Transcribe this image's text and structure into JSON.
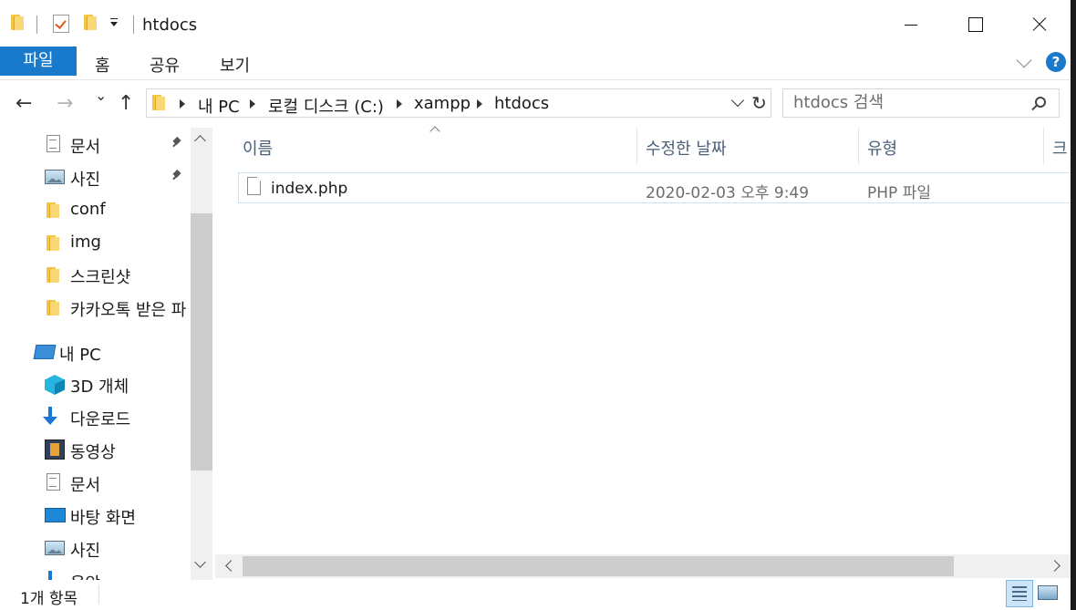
{
  "window": {
    "title": "htdocs"
  },
  "ribbon": {
    "tabs": [
      "파일",
      "홈",
      "공유",
      "보기"
    ],
    "help_label": "?"
  },
  "address": {
    "crumbs": [
      "내 PC",
      "로컬 디스크 (C:)",
      "xampp",
      "htdocs"
    ],
    "refresh_glyph": "↻"
  },
  "nav": {
    "back": "←",
    "forward": "→",
    "recent": "⌄",
    "up": "↑"
  },
  "search": {
    "placeholder": "htdocs 검색"
  },
  "navpane": {
    "quick": [
      {
        "label": "문서",
        "icon": "document-icon",
        "pinned": true
      },
      {
        "label": "사진",
        "icon": "pictures-icon",
        "pinned": true
      },
      {
        "label": "conf",
        "icon": "folder-icon",
        "pinned": false
      },
      {
        "label": "img",
        "icon": "folder-icon",
        "pinned": false
      },
      {
        "label": "스크린샷",
        "icon": "folder-icon",
        "pinned": false
      },
      {
        "label": "카카오톡 받은 파",
        "icon": "folder-icon",
        "pinned": false
      }
    ],
    "thispc_label": "내 PC",
    "thispc": [
      {
        "label": "3D 개체",
        "icon": "3d-objects-icon"
      },
      {
        "label": "다운로드",
        "icon": "downloads-icon"
      },
      {
        "label": "동영상",
        "icon": "videos-icon"
      },
      {
        "label": "문서",
        "icon": "document-icon"
      },
      {
        "label": "바탕 화면",
        "icon": "desktop-icon"
      },
      {
        "label": "사진",
        "icon": "pictures-icon"
      },
      {
        "label": "음악",
        "icon": "music-icon"
      }
    ]
  },
  "filelist": {
    "columns": [
      "이름",
      "수정한 날짜",
      "유형",
      "크"
    ],
    "rows": [
      {
        "name": "index.php",
        "modified": "2020-02-03 오후 9:49",
        "type": "PHP 파일"
      }
    ]
  },
  "status": {
    "text": "1개 항목"
  },
  "colors": {
    "accent": "#1979ca",
    "selection_border": "#cce4f7",
    "header_text": "#4c607a"
  }
}
